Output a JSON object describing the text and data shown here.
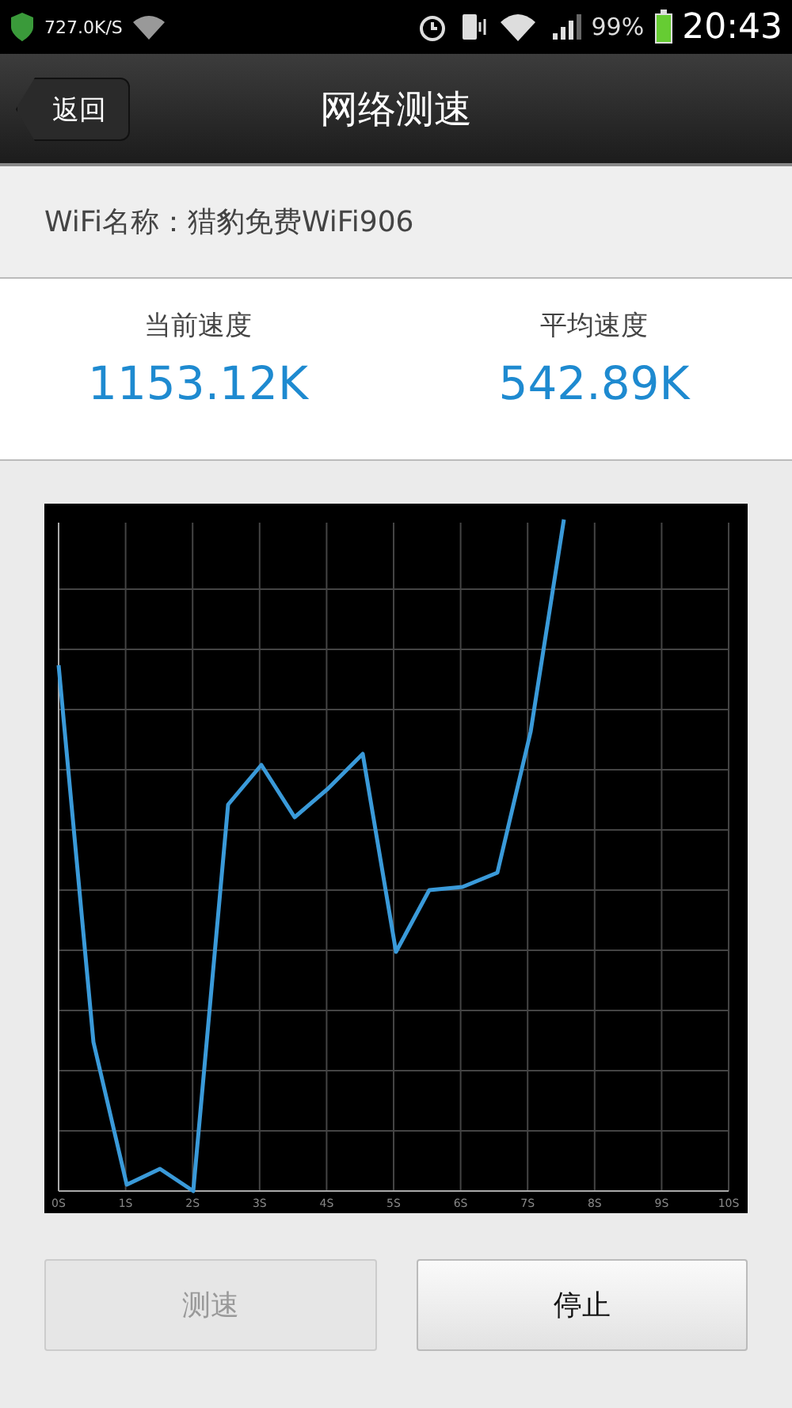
{
  "status_bar": {
    "net_speed": "727.0K/S",
    "battery": "99%",
    "time": "20:43"
  },
  "header": {
    "back": "返回",
    "title": "网络测速"
  },
  "wifi": {
    "label": "WiFi名称：猎豹免费WiFi906"
  },
  "speeds": [
    {
      "label": "当前速度",
      "value": "1153.12K"
    },
    {
      "label": "平均速度",
      "value": "542.89K"
    }
  ],
  "chart": {
    "x_labels": [
      "0S",
      "1S",
      "2S",
      "3S",
      "4S",
      "5S",
      "6S",
      "7S",
      "8S",
      "9S",
      "10S"
    ]
  },
  "buttons": [
    {
      "label": "测速",
      "disabled": true
    },
    {
      "label": "停止",
      "disabled": false
    }
  ]
}
